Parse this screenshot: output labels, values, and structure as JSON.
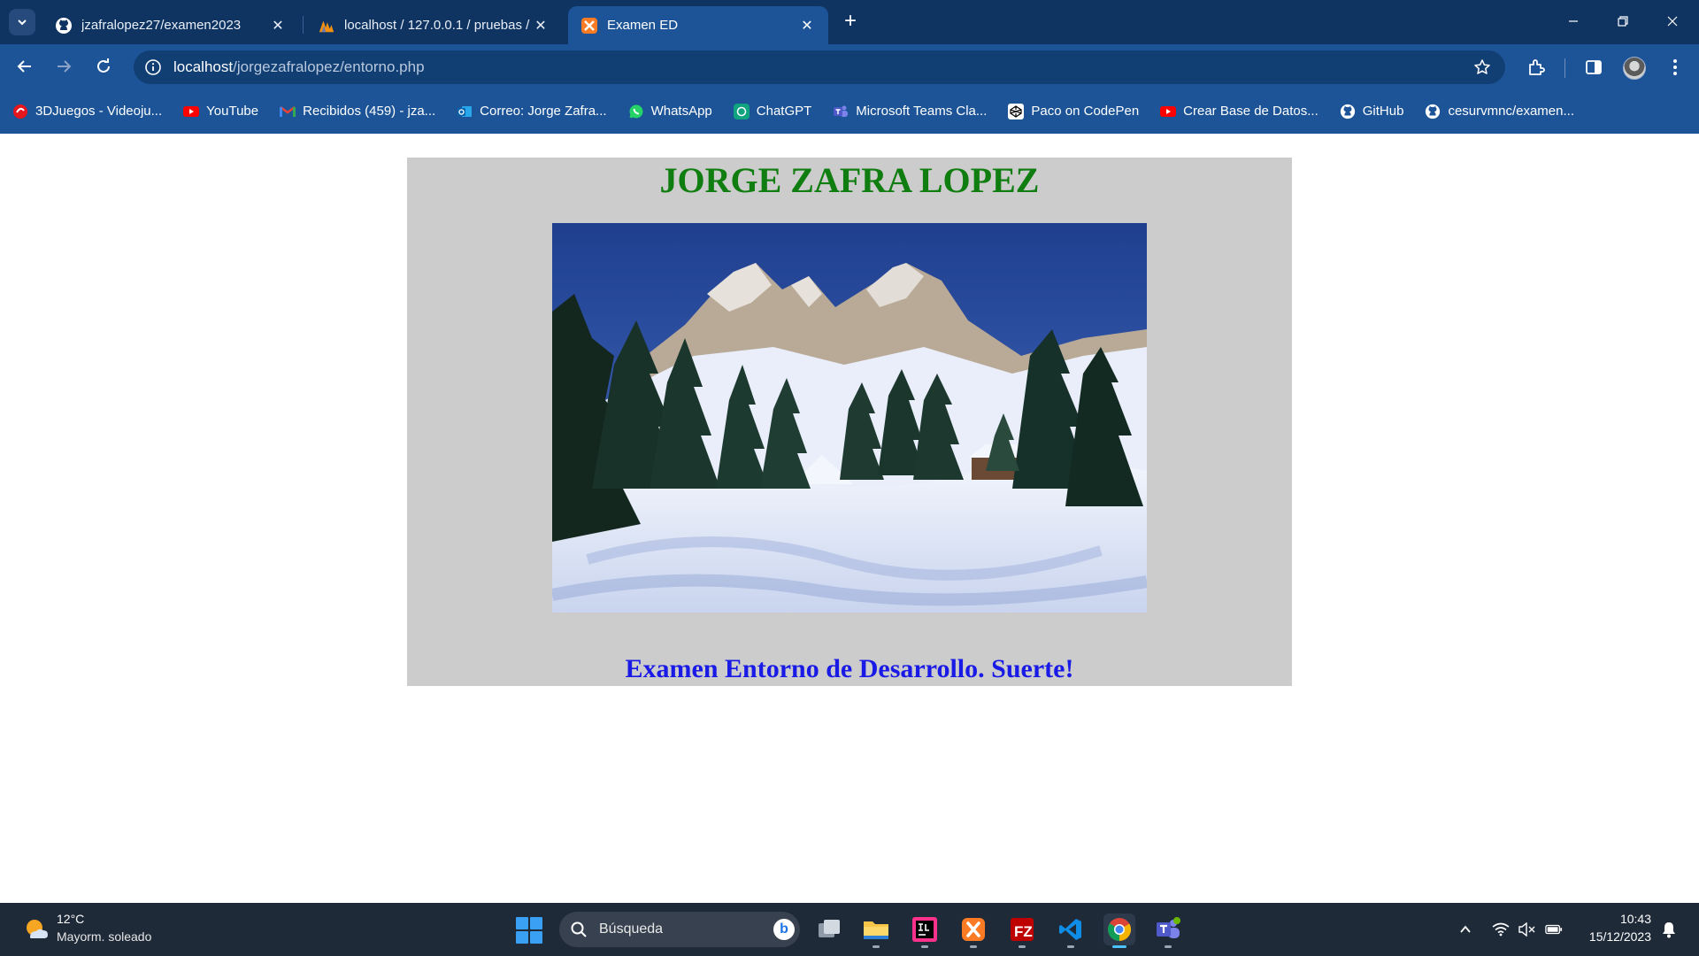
{
  "browser": {
    "tabs": [
      {
        "title": "jzafralopez27/examen2023",
        "favicon": "github-icon",
        "active": false
      },
      {
        "title": "localhost / 127.0.0.1 / pruebas /",
        "favicon": "phpmyadmin-icon",
        "active": false
      },
      {
        "title": "Examen ED",
        "favicon": "xampp-icon",
        "active": true
      }
    ],
    "address": {
      "host": "localhost",
      "path": "/jorgezafralopez/entorno.php"
    },
    "bookmarks": [
      {
        "label": "3DJuegos - Videoju...",
        "icon": "3djuegos-icon"
      },
      {
        "label": "YouTube",
        "icon": "youtube-icon"
      },
      {
        "label": "Recibidos (459) - jza...",
        "icon": "gmail-icon"
      },
      {
        "label": "Correo: Jorge Zafra...",
        "icon": "outlook-icon"
      },
      {
        "label": "WhatsApp",
        "icon": "whatsapp-icon"
      },
      {
        "label": "ChatGPT",
        "icon": "chatgpt-icon"
      },
      {
        "label": "Microsoft Teams Cla...",
        "icon": "teams-icon"
      },
      {
        "label": "Paco on CodePen",
        "icon": "codepen-icon"
      },
      {
        "label": "Crear Base de Datos...",
        "icon": "youtube-icon"
      },
      {
        "label": "GitHub",
        "icon": "github-icon"
      },
      {
        "label": "cesurvmnc/examen...",
        "icon": "github-icon"
      }
    ]
  },
  "page": {
    "heading": "JORGE ZAFRA LOPEZ",
    "subtitle": "Examen Entorno de Desarrollo. Suerte!",
    "image_subject": "snowy mountain landscape with pine trees"
  },
  "taskbar": {
    "weather": {
      "temp": "12°C",
      "condition": "Mayorm. soleado"
    },
    "search_placeholder": "Búsqueda",
    "apps": [
      "task-view-icon",
      "file-explorer-icon",
      "intellij-icon",
      "xampp-icon",
      "filezilla-icon",
      "vscode-icon",
      "chrome-icon",
      "teams-icon"
    ],
    "clock": {
      "time": "10:43",
      "date": "15/12/2023"
    }
  },
  "colors": {
    "tabstrip": "#0f3461",
    "toolbar": "#1c5497",
    "panel": "#cccccc",
    "heading": "#0f7d0f",
    "subtitle": "#1a1ae6",
    "taskbar": "#1f2a38"
  }
}
